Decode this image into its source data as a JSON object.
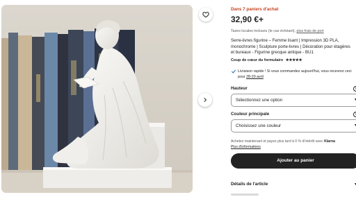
{
  "product": {
    "carts_text": "Dans 7 paniers d'achat",
    "price": "32,90 €+",
    "tax_text": "Taxes locales incluses (le cas échéant),",
    "shipping_link": "plus frais de port",
    "title": "Serre-livres figurine – Femme lisant | Impression 3D PLA, monochrome | Sculpture porte-livres | Décoration pour étagères et bureaux - Figurine grecque antique - BU1",
    "tag_label": "Coup de cœur du formulaire",
    "tag_stars": "★★★★★",
    "delivery_text": "Livraison rapide ! Si vous commandez aujourd'hui, vous recevrez ceci pour",
    "delivery_date": "28-29 avril"
  },
  "options": {
    "height_label": "Hauteur",
    "height_placeholder": "Sélectionnez une option",
    "color_label": "Couleur principale",
    "color_placeholder": "Choisissez une couleur"
  },
  "payment": {
    "klarna_text": "Achetez maintenant et payez plus tard à 0 % d'intérêt avec",
    "klarna_brand": "Klarna",
    "klarna_more": "Plus d'informations"
  },
  "actions": {
    "add_to_cart": "Ajouter au panier",
    "details": "Détails de l'article"
  },
  "colors": {
    "accent_red": "#c4411e",
    "button_dark": "#222222"
  }
}
